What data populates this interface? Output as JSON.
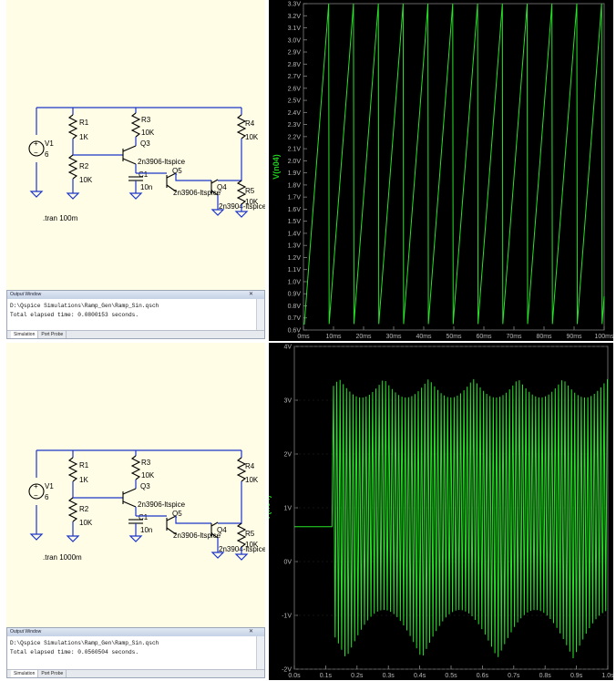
{
  "top": {
    "schematic": {
      "source": {
        "name": "V1",
        "value": "6"
      },
      "resistors": [
        {
          "name": "R1",
          "value": "1K"
        },
        {
          "name": "R2",
          "value": "10K"
        },
        {
          "name": "R3",
          "value": "10K"
        },
        {
          "name": "R4",
          "value": "10K"
        },
        {
          "name": "R5",
          "value": "10K"
        }
      ],
      "capacitor": {
        "name": "C1",
        "value": "10n"
      },
      "transistors": [
        {
          "name": "Q3",
          "model": "2n3906-ltspice"
        },
        {
          "name": "Q5",
          "model": "2n3906-ltspice"
        },
        {
          "name": "Q4",
          "model": "2n3904-ltspice"
        }
      ],
      "directive": ".tran 100m"
    },
    "output": {
      "title": "Output Window",
      "path": "D:\\Qspice Simulations\\Ramp_Gen\\Ramp_Sin.qsch",
      "elapsed": "Total elapsed time: 0.0800153 seconds.",
      "tabs": [
        "Simulation",
        "Port Probe"
      ]
    },
    "chart_data": {
      "type": "line",
      "ylabel": "V(n04)",
      "y_ticks": [
        "0.6V",
        "0.7V",
        "0.8V",
        "0.9V",
        "1.0V",
        "1.1V",
        "1.2V",
        "1.3V",
        "1.4V",
        "1.5V",
        "1.6V",
        "1.7V",
        "1.8V",
        "1.9V",
        "2.0V",
        "2.1V",
        "2.2V",
        "2.3V",
        "2.4V",
        "2.5V",
        "2.6V",
        "2.7V",
        "2.8V",
        "2.9V",
        "3.0V",
        "3.1V",
        "3.2V",
        "3.3V"
      ],
      "x_ticks": [
        "0ms",
        "10ms",
        "20ms",
        "30ms",
        "40ms",
        "50ms",
        "60ms",
        "70ms",
        "80ms",
        "90ms",
        "100ms"
      ],
      "xlim": [
        0,
        100
      ],
      "ylim": [
        0.6,
        3.3
      ],
      "series": [
        {
          "color": "#27e327",
          "shape": "sawtooth",
          "period_ms": 8.4,
          "low_V": 0.65,
          "high_V": 3.3
        }
      ]
    }
  },
  "bottom": {
    "schematic": {
      "source": {
        "name": "V1",
        "value": "6"
      },
      "resistors": [
        {
          "name": "R1",
          "value": "1K"
        },
        {
          "name": "R2",
          "value": "10K"
        },
        {
          "name": "R3",
          "value": "10K"
        },
        {
          "name": "R4",
          "value": "10K"
        },
        {
          "name": "R5",
          "value": "10K"
        }
      ],
      "capacitor": {
        "name": "C1",
        "value": "10n"
      },
      "transistors": [
        {
          "name": "Q3",
          "model": "2n3906-ltspice"
        },
        {
          "name": "Q5",
          "model": "2n3906-ltspice"
        },
        {
          "name": "Q4",
          "model": "2n3904-ltspice"
        }
      ],
      "directive": ".tran 1000m"
    },
    "output": {
      "title": "Output Window",
      "path": "D:\\Qspice Simulations\\Ramp_Gen\\Ramp_Sin.qsch",
      "elapsed": "Total elapsed time: 0.0560504 seconds.",
      "tabs": [
        "Simulation",
        "Port Probe"
      ]
    },
    "chart_data": {
      "type": "line",
      "ylabel": "V(n04)",
      "y_ticks": [
        "-2V",
        "-1V",
        "0V",
        "1V",
        "2V",
        "3V",
        "4V"
      ],
      "x_ticks": [
        "0.0s",
        "0.1s",
        "0.2s",
        "0.3s",
        "0.4s",
        "0.5s",
        "0.6s",
        "0.7s",
        "0.8s",
        "0.9s",
        "1.0s"
      ],
      "xlim": [
        0,
        1.0
      ],
      "ylim": [
        -2,
        4
      ],
      "series": [
        {
          "color": "#27e327",
          "shape": "aliased oscillation",
          "flat_until_s": 0.12,
          "flat_V": 0.65,
          "low_V": -1.8,
          "high_V": 3.4
        }
      ]
    }
  }
}
